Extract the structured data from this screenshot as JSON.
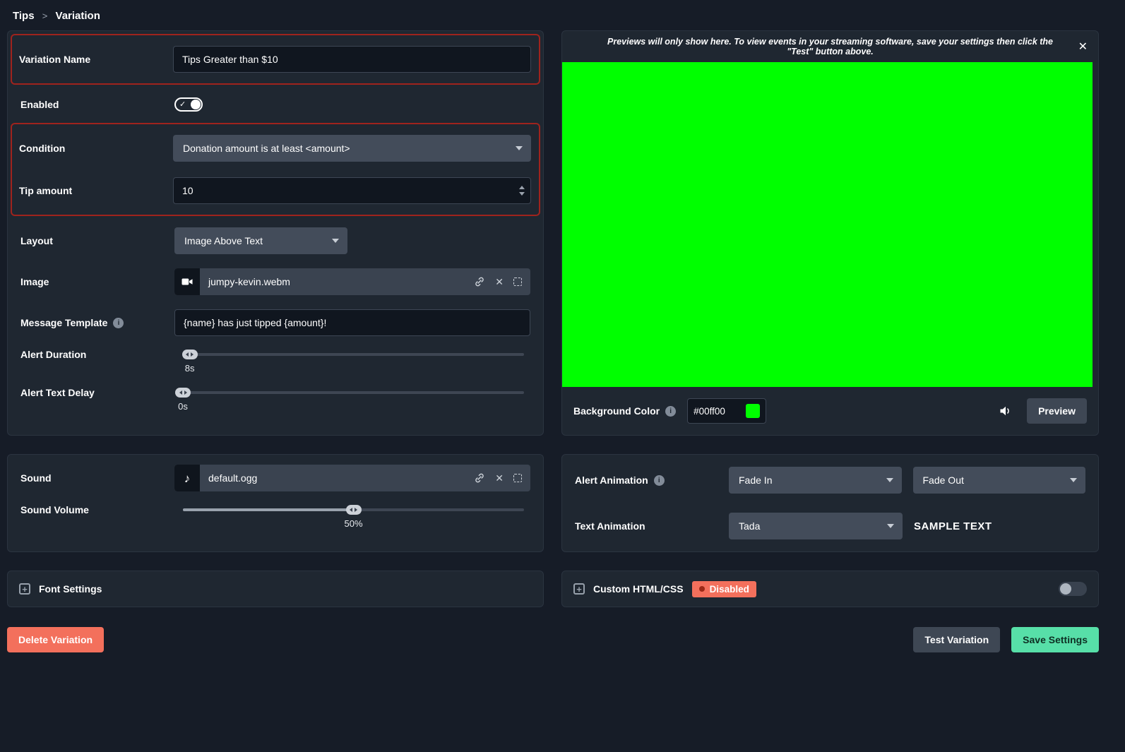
{
  "breadcrumb": {
    "root": "Tips",
    "separator": ">",
    "current": "Variation"
  },
  "icons": {
    "check": "✓",
    "close": "✕",
    "music_note": "♪",
    "info": "i",
    "plus": "+"
  },
  "variation": {
    "name": {
      "label": "Variation Name",
      "value": "Tips Greater than $10"
    },
    "enabled": {
      "label": "Enabled",
      "state": "on"
    },
    "condition": {
      "label": "Condition",
      "selected": "Donation amount is at least <amount>"
    },
    "tip_amount": {
      "label": "Tip amount",
      "value": "10"
    },
    "layout": {
      "label": "Layout",
      "selected": "Image Above Text"
    },
    "image": {
      "label": "Image",
      "filename": "jumpy-kevin.webm"
    },
    "message_template": {
      "label": "Message Template",
      "value": "{name} has just tipped {amount}!"
    },
    "alert_duration": {
      "label": "Alert Duration",
      "display": "8s",
      "percent": 2
    },
    "alert_text_delay": {
      "label": "Alert Text Delay",
      "display": "0s",
      "percent": 0
    },
    "sound": {
      "label": "Sound",
      "filename": "default.ogg"
    },
    "sound_volume": {
      "label": "Sound Volume",
      "display": "50%",
      "percent": 50
    },
    "font_settings": {
      "label": "Font Settings"
    },
    "delete_button": "Delete Variation"
  },
  "preview": {
    "notice": "Previews will only show here. To view events in your streaming software, save your settings then click the \"Test\" button above.",
    "background_color": {
      "label": "Background Color",
      "value": "#00ff00"
    },
    "preview_button": "Preview"
  },
  "animations": {
    "alert_animation": {
      "label": "Alert Animation",
      "entry": "Fade In",
      "exit": "Fade Out"
    },
    "text_animation": {
      "label": "Text Animation",
      "selected": "Tada",
      "sample": "SAMPLE TEXT"
    }
  },
  "custom_code": {
    "label": "Custom HTML/CSS",
    "status": "Disabled"
  },
  "footer": {
    "test_button": "Test Variation",
    "save_button": "Save Settings"
  },
  "colors": {
    "highlight_border": "#9f231d",
    "danger": "#f3705c",
    "success": "#57dfa8",
    "preview_background": "#00ff00"
  }
}
